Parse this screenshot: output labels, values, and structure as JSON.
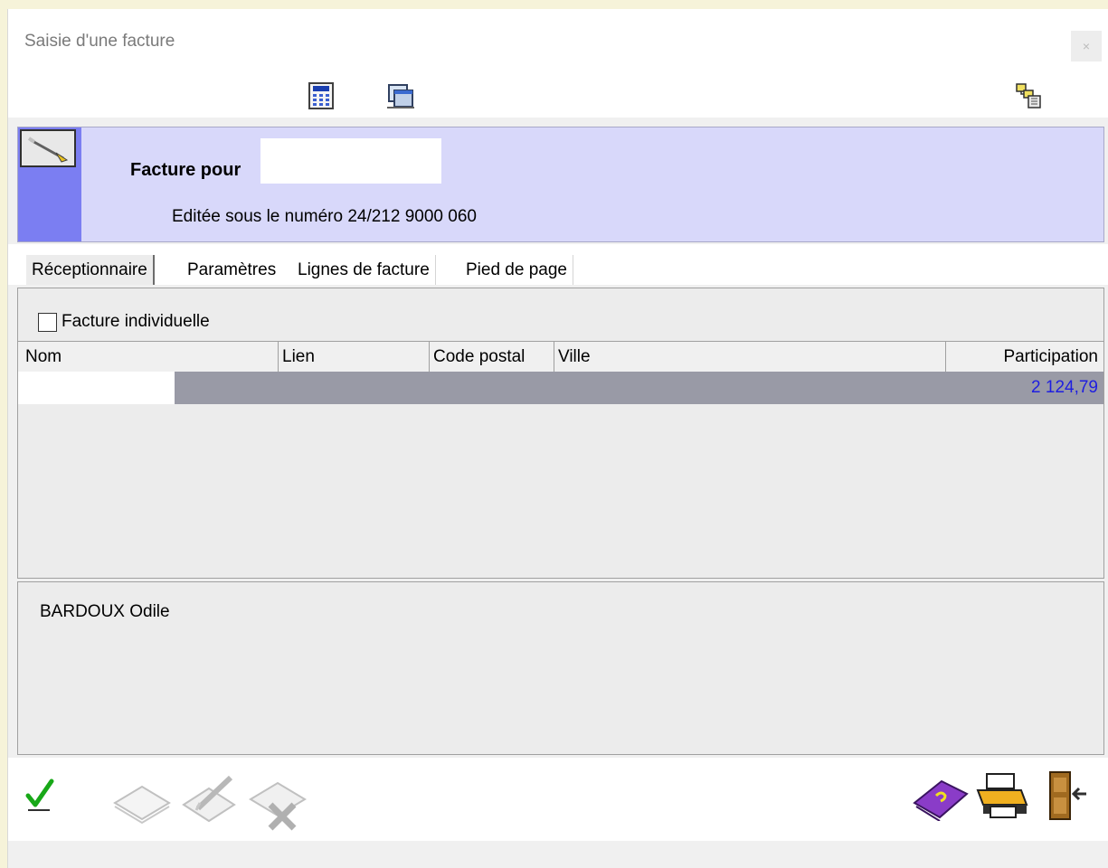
{
  "window": {
    "title": "Saisie d'une facture",
    "close_label": "×"
  },
  "toolbar": {
    "icons": [
      "calculator-icon",
      "window-icon",
      "linked-documents-icon"
    ]
  },
  "header": {
    "facture_label": "Facture pour",
    "edit_line": "Editée sous le numéro 24/212 9000 060",
    "icon": "edit-document-icon",
    "strip_color": "#7b7ef2",
    "panel_color": "#d8d8fa"
  },
  "tabs": [
    {
      "label": "Réceptionnaire",
      "active": true
    },
    {
      "label": "Paramètres",
      "active": false
    },
    {
      "label": "Lignes de facture",
      "active": false
    },
    {
      "label": "Pied de page",
      "active": false
    }
  ],
  "form": {
    "checkbox_label": "Facture individuelle",
    "checkbox_checked": false
  },
  "grid": {
    "columns": [
      "Nom",
      "Lien",
      "Code postal",
      "Ville",
      "Participation"
    ],
    "rows": [
      {
        "nom": "",
        "lien": "",
        "code_postal": "",
        "ville": "",
        "participation": "2 124,79"
      }
    ],
    "selected_row_color": "#999aa6",
    "value_color": "#1e1ee0"
  },
  "recipient": {
    "name": "BARDOUX Odile"
  },
  "bottom": {
    "left_icons": [
      "validate-check-icon",
      "new-document-icon",
      "edit-document-icon",
      "delete-document-icon"
    ],
    "right_icons": [
      "help-book-icon",
      "printer-icon",
      "exit-door-icon"
    ]
  }
}
